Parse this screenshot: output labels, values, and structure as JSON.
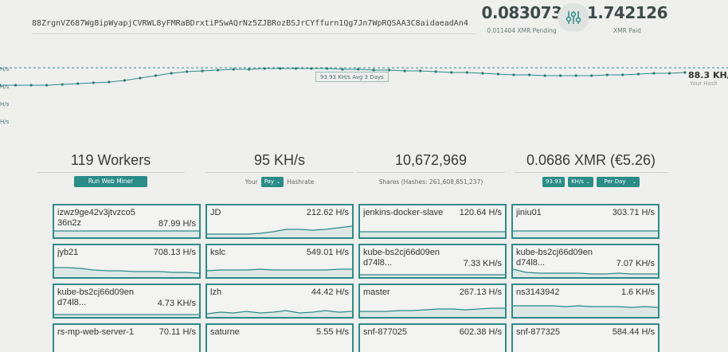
{
  "address": "88ZrgnVZ687Wg8ipWyapjCVRWL8yFMRaBDrxtiPSwAQrNz5ZJBRozBSJrCYffurn1Qg7Jn7WpRQSAA3C8aidaeadAn4",
  "pending": {
    "value": "0.083073",
    "label": "0.011404 XMR Pending"
  },
  "paid": {
    "value": "1.742126",
    "label": "XMR Paid"
  },
  "settings_icon": "sliders-icon",
  "hashrate_chart": {
    "y_labels": [
      "H/s",
      "H/s",
      "H/s",
      "H/s"
    ],
    "avg_label": "93.93 KH/s Avg 3 Days",
    "current_rate": "88.3 KH/s",
    "current_label": "Your Hash"
  },
  "chart_data": {
    "type": "line",
    "series": [
      {
        "values": [
          72,
          72,
          72,
          72,
          73,
          74,
          75,
          76,
          78,
          81,
          84,
          87,
          89,
          90,
          91,
          92,
          92,
          93,
          93,
          93,
          93,
          93,
          92,
          92,
          91,
          91,
          90,
          90,
          89,
          88,
          88,
          87,
          86,
          85,
          85,
          84,
          84,
          84,
          84,
          85,
          85,
          86,
          87,
          87,
          88
        ]
      }
    ],
    "avg": 93.93
  },
  "summary": {
    "workers": {
      "value": "119 Workers",
      "button": "Run Web Miner"
    },
    "hashrate": {
      "value": "95 KH/s",
      "prefix": "Your",
      "select": "Pay",
      "suffix": "Hashrate"
    },
    "shares": {
      "value": "10,672,969",
      "sub": "Shares (Hashes: 261,608,851,237)"
    },
    "earnings": {
      "value": "0.0686 XMR (€5.26)",
      "rate": "93.93",
      "unit": "KH/s",
      "period": "Per Day"
    }
  },
  "workers": [
    {
      "name": "izwz9ge42v3jtvzco536n2z",
      "rate": "87.99 H/s",
      "spark": [
        8,
        8,
        8,
        8,
        8,
        8,
        8,
        8,
        8,
        8,
        8,
        8
      ]
    },
    {
      "name": "JD",
      "rate": "212.62 H/s",
      "spark": [
        4,
        4,
        4,
        4,
        5,
        7,
        10,
        10,
        9,
        10,
        12,
        14
      ]
    },
    {
      "name": "jenkins-docker-slave",
      "rate": "120.64 H/s",
      "spark": [
        7,
        7,
        7,
        7,
        7,
        7,
        7,
        7,
        7,
        7,
        7,
        7
      ]
    },
    {
      "name": "jiniu01",
      "rate": "303.71 H/s",
      "spark": [
        8,
        8,
        8,
        8,
        8,
        8,
        8,
        8,
        8,
        8,
        8,
        8
      ]
    },
    {
      "name": "jyb21",
      "rate": "708.13 H/s",
      "spark": [
        12,
        12,
        11,
        9,
        8,
        8,
        7,
        7,
        7,
        6,
        6,
        5
      ]
    },
    {
      "name": "kslc",
      "rate": "549.01 H/s",
      "spark": [
        8,
        9,
        9,
        9,
        10,
        9,
        9,
        9,
        9,
        9,
        10,
        10
      ]
    },
    {
      "name": "kube-bs2cj66d09end74l8...",
      "rate": "7.33 KH/s",
      "spark": [
        3,
        3,
        3,
        3,
        3,
        3,
        3,
        3,
        3,
        3,
        3,
        3
      ]
    },
    {
      "name": "kube-bs2cj66d09end74l8...",
      "rate": "7.07 KH/s",
      "spark": [
        10,
        6,
        5,
        5,
        5,
        5,
        4,
        4,
        5,
        4,
        4,
        4
      ]
    },
    {
      "name": "kube-bs2cj66d09end74l8...",
      "rate": "4.73 KH/s",
      "spark": [
        3,
        3,
        3,
        3,
        3,
        3,
        3,
        3,
        3,
        3,
        3,
        3
      ]
    },
    {
      "name": "lzh",
      "rate": "44.42 H/s",
      "spark": [
        4,
        6,
        5,
        7,
        5,
        6,
        8,
        5,
        6,
        8,
        6,
        7
      ]
    },
    {
      "name": "master",
      "rate": "267.13 H/s",
      "spark": [
        7,
        7,
        7,
        8,
        8,
        9,
        10,
        10,
        9,
        10,
        11,
        11
      ]
    },
    {
      "name": "ns3143942",
      "rate": "1.6 KH/s",
      "spark": [
        14,
        14,
        14,
        14,
        13,
        14,
        13,
        13,
        13,
        12,
        13,
        12
      ]
    },
    {
      "name": "rs-mp-web-server-1",
      "rate": "70.11 H/s",
      "spark": [
        4,
        4,
        4,
        4,
        4,
        4,
        4,
        4,
        4,
        4,
        4,
        4
      ]
    },
    {
      "name": "saturne",
      "rate": "5.55 H/s",
      "spark": [
        4,
        4,
        4,
        4,
        4,
        4,
        4,
        4,
        4,
        4,
        4,
        4
      ]
    },
    {
      "name": "snf-877025",
      "rate": "602.38 H/s",
      "spark": [
        4,
        4,
        4,
        4,
        4,
        4,
        4,
        4,
        4,
        4,
        4,
        4
      ]
    },
    {
      "name": "snf-877325",
      "rate": "584.44 H/s",
      "spark": [
        4,
        4,
        4,
        4,
        4,
        4,
        4,
        4,
        4,
        4,
        4,
        4
      ]
    }
  ]
}
